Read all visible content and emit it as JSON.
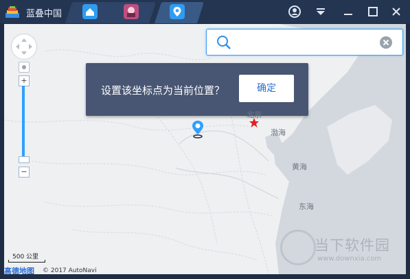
{
  "titlebar": {
    "title": "蓝叠中国",
    "tabs": [
      {
        "icon": "home-icon"
      },
      {
        "icon": "game-icon"
      },
      {
        "icon": "location-pin-icon"
      }
    ],
    "controls": [
      "account-icon",
      "menu-dropdown-icon",
      "minimize-icon",
      "maximize-icon",
      "close-icon"
    ]
  },
  "search": {
    "value": "",
    "placeholder": ""
  },
  "dialog": {
    "message": "设置该坐标点为当前位置？",
    "confirm_label": "确定"
  },
  "map": {
    "labels": {
      "beijing": "北京",
      "bohai": "渤海",
      "yellow_sea": "黄海",
      "east_sea": "东海"
    },
    "scale": "500 公里",
    "provider": "高德地图",
    "copyright": "© 2017 AutoNavi",
    "accent_color": "#2ea0ff",
    "pin_color": "#2ea0ff",
    "capital_color": "#e02020"
  },
  "watermark": {
    "text": "当下软件园",
    "url": "www.downxia.com"
  }
}
